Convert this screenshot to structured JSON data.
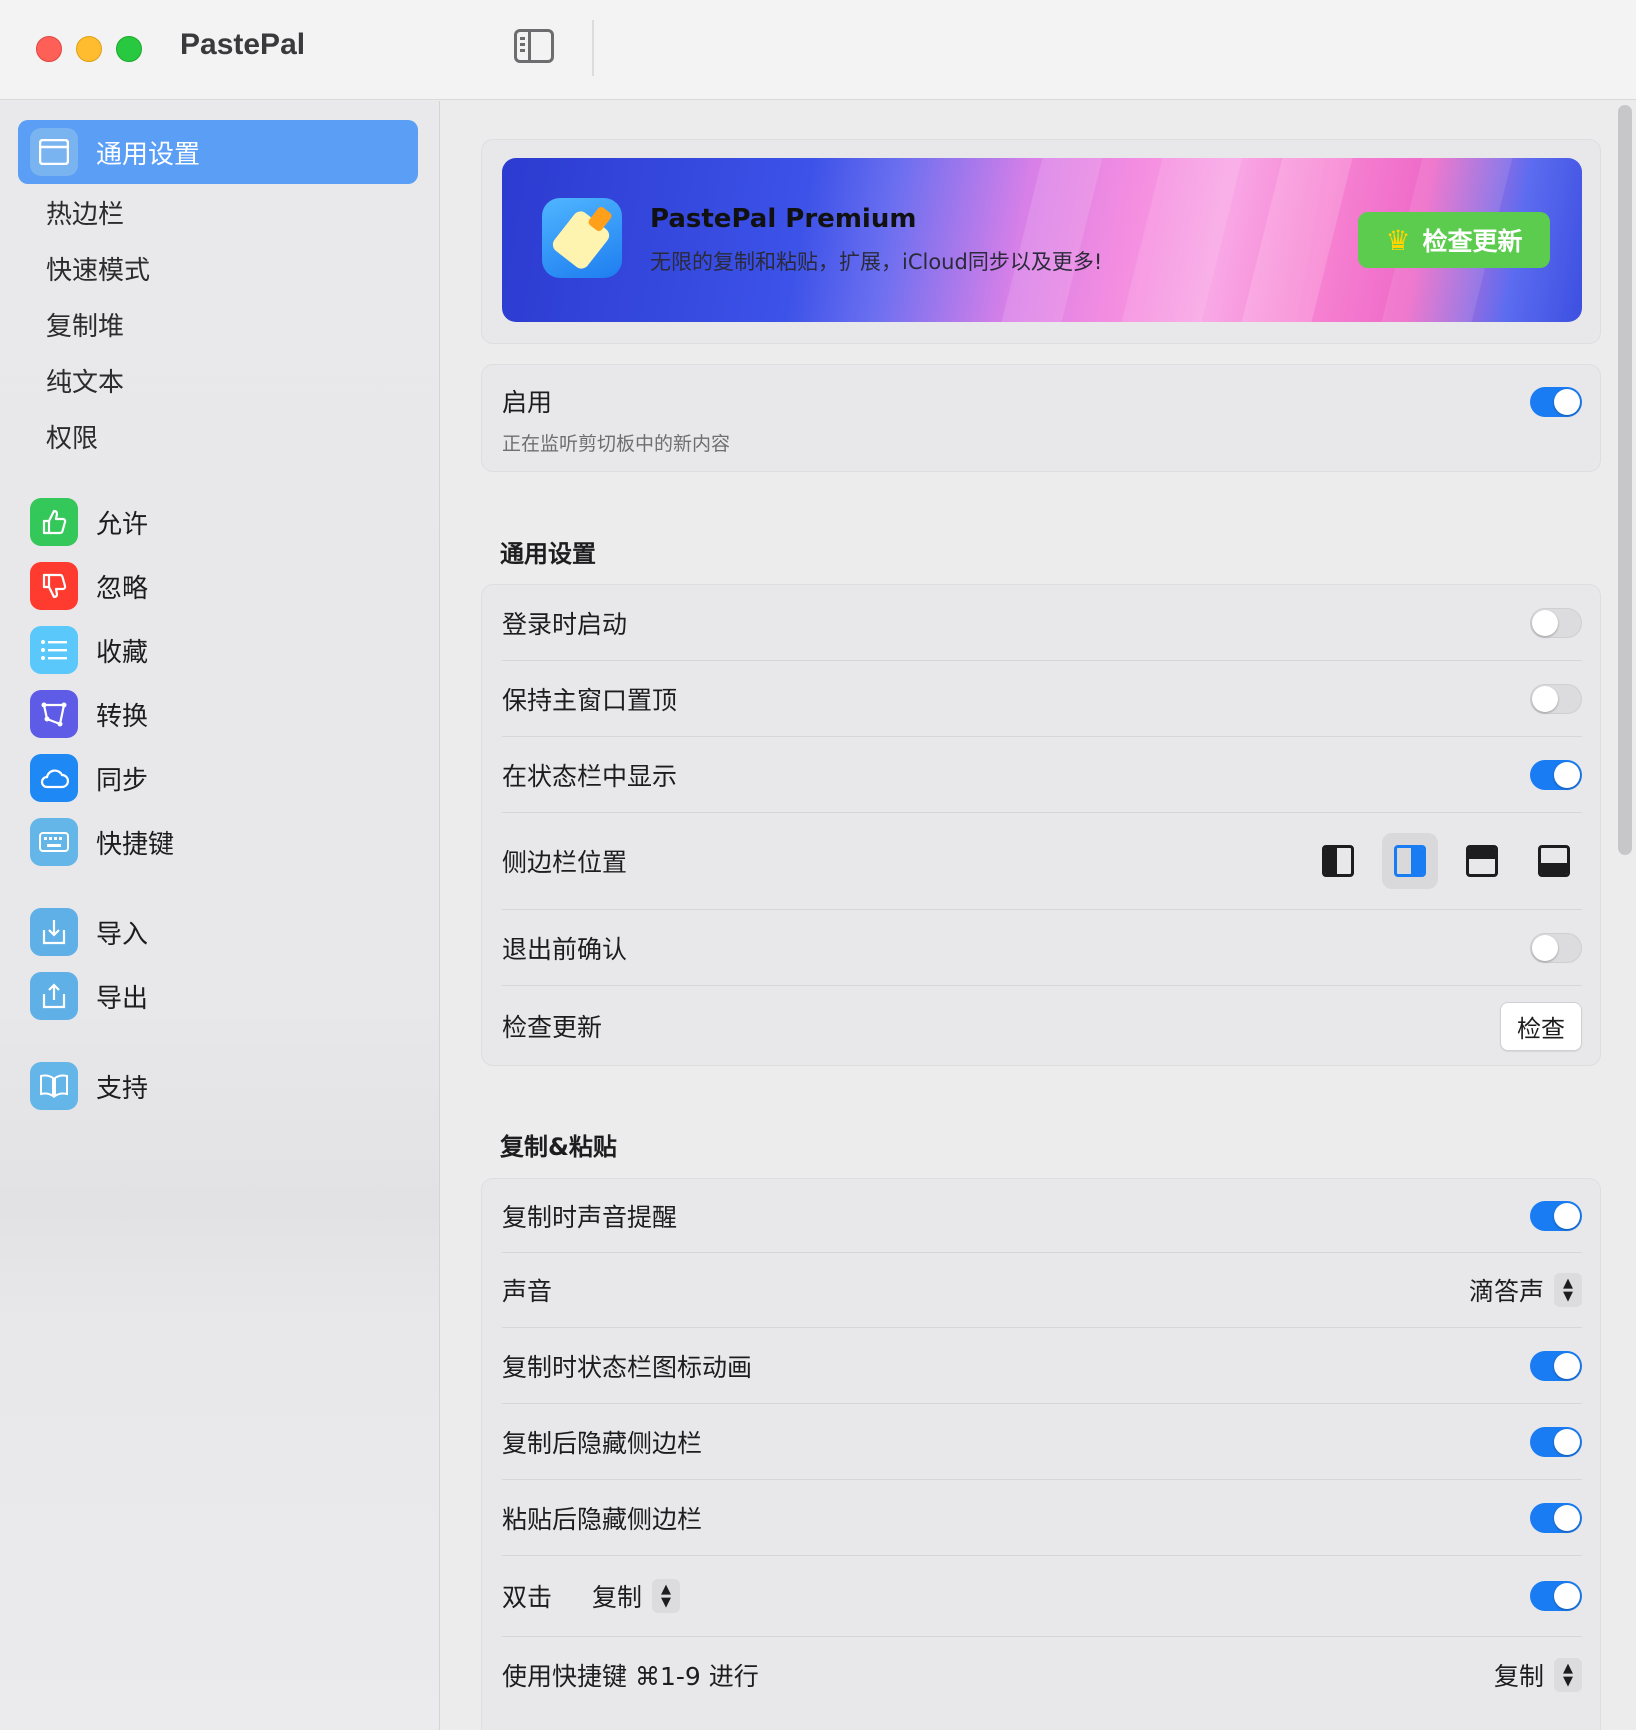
{
  "window": {
    "title": "PastePal"
  },
  "sidebar": {
    "top_items": [
      {
        "label": "通用设置",
        "active": true
      },
      {
        "label": "热边栏"
      },
      {
        "label": "快速模式"
      },
      {
        "label": "复制堆"
      },
      {
        "label": "纯文本"
      },
      {
        "label": "权限"
      }
    ],
    "rule_items": [
      {
        "label": "允许",
        "icon": "thumbs-up-icon",
        "color": "#34c759"
      },
      {
        "label": "忽略",
        "icon": "thumbs-down-icon",
        "color": "#ff3b30"
      },
      {
        "label": "收藏",
        "icon": "list-icon",
        "color": "#5ac8fa"
      },
      {
        "label": "转换",
        "icon": "transform-icon",
        "color": "#5e5ce6"
      },
      {
        "label": "同步",
        "icon": "cloud-icon",
        "color": "#1e88f5"
      },
      {
        "label": "快捷键",
        "icon": "keyboard-icon",
        "color": "#64b5e8"
      }
    ],
    "io_items": [
      {
        "label": "导入",
        "icon": "import-icon",
        "color": "#5fb0e6"
      },
      {
        "label": "导出",
        "icon": "export-icon",
        "color": "#5fb0e6"
      }
    ],
    "support_item": {
      "label": "支持",
      "icon": "book-icon",
      "color": "#64b5e8"
    }
  },
  "banner": {
    "title": "PastePal Premium",
    "subtitle": "无限的复制和粘贴，扩展，iCloud同步以及更多!",
    "button_label": "检查更新"
  },
  "enable": {
    "label": "启用",
    "sublabel": "正在监听剪切板中的新内容",
    "on": true
  },
  "general": {
    "title": "通用设置",
    "launch_at_login": {
      "label": "登录时启动",
      "on": false
    },
    "keep_on_top": {
      "label": "保持主窗口置顶",
      "on": false
    },
    "show_in_status_bar": {
      "label": "在状态栏中显示",
      "on": true
    },
    "sidebar_position": {
      "label": "侧边栏位置",
      "selected": "right"
    },
    "confirm_quit": {
      "label": "退出前确认",
      "on": false
    },
    "check_updates": {
      "label": "检查更新",
      "button": "检查"
    }
  },
  "copy_paste": {
    "title": "复制&粘贴",
    "sound_on_copy": {
      "label": "复制时声音提醒",
      "on": true
    },
    "sound": {
      "label": "声音",
      "value": "滴答声"
    },
    "animate_status_icon": {
      "label": "复制时状态栏图标动画",
      "on": true
    },
    "hide_after_copy": {
      "label": "复制后隐藏侧边栏",
      "on": true
    },
    "hide_after_paste": {
      "label": "粘贴后隐藏侧边栏",
      "on": true
    },
    "double_click": {
      "label": "双击",
      "value": "复制",
      "on": true
    },
    "shortcut_action": {
      "label": "使用快捷键 ⌘1-9 进行",
      "value": "复制"
    }
  },
  "colors": {
    "accent": "#1a7cf2",
    "sidebar_active": "#5b9ef5",
    "premium_button": "#5bcc4e"
  }
}
